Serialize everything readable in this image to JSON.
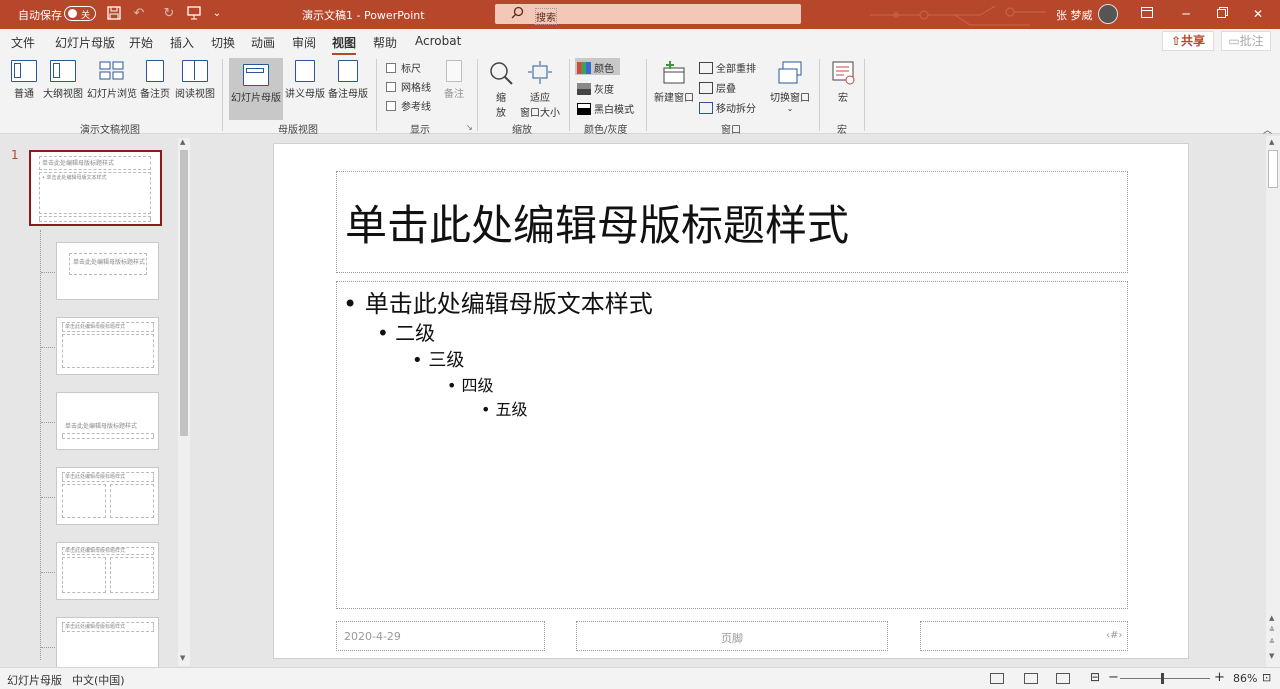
{
  "titlebar": {
    "autosave_label": "自动保存",
    "autosave_state": "关",
    "doc_title": "演示文稿1  -  PowerPoint",
    "search_placeholder": "搜索",
    "user_name": "张 梦威",
    "accent_color": "#b7472a"
  },
  "menu": {
    "tabs": [
      "文件",
      "幻灯片母版",
      "开始",
      "插入",
      "切换",
      "动画",
      "审阅",
      "视图",
      "帮助",
      "Acrobat"
    ],
    "active_tab": "视图",
    "share_label": "共享",
    "comment_label": "批注"
  },
  "ribbon": {
    "presentation_views": {
      "label": "演示文稿视图",
      "buttons": [
        "普通",
        "大纲视图",
        "幻灯片浏览",
        "备注页",
        "阅读视图"
      ]
    },
    "master_views": {
      "label": "母版视图",
      "buttons": [
        "幻灯片母版",
        "讲义母版",
        "备注母版"
      ]
    },
    "show": {
      "label": "显示",
      "checkboxes": [
        "标尺",
        "网格线",
        "参考线"
      ],
      "notes_label": "备注"
    },
    "zoom": {
      "label": "缩放",
      "zoom_label_1": "缩",
      "zoom_label_2": "放",
      "fit_label_1": "适应",
      "fit_label_2": "窗口大小"
    },
    "color": {
      "label": "颜色/灰度",
      "items": [
        "颜色",
        "灰度",
        "黑白模式"
      ]
    },
    "window": {
      "label": "窗口",
      "new_window": "新建窗口",
      "arrange_all": "全部重排",
      "cascade": "层叠",
      "move_split": "移动拆分",
      "switch_window": "切换窗口"
    },
    "macros": {
      "label": "宏",
      "button": "宏"
    }
  },
  "thumbnails": {
    "master_number": "1",
    "master_title": "单击此处编辑母版标题样式",
    "master_text": "• 单击此处编辑母版文本样式",
    "layout_title": "单击此处编辑母版标题样式"
  },
  "slide": {
    "title": "单击此处编辑母版标题样式",
    "level1": "单击此处编辑母版文本样式",
    "level2": "二级",
    "level3": "三级",
    "level4": "四级",
    "level5": "五级",
    "footer_date": "2020-4-29",
    "footer_center": "页脚",
    "footer_number": "‹#›"
  },
  "statusbar": {
    "view_name": "幻灯片母版",
    "language": "中文(中国)",
    "zoom_percent": "86%",
    "zoom_level": 0.86
  }
}
